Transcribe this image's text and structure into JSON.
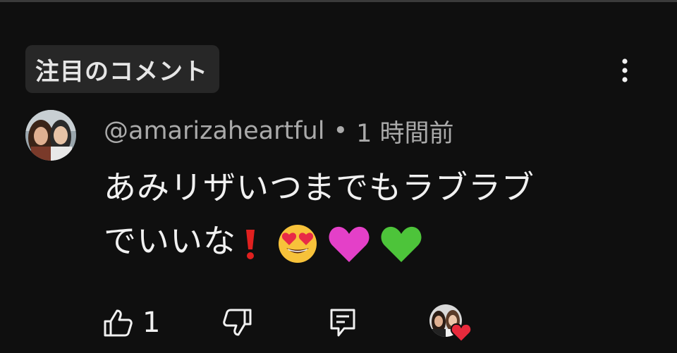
{
  "section": {
    "chip_label": "注目のコメント"
  },
  "comment": {
    "author": "@amarizaheartful",
    "separator": "•",
    "time": "1 時間前",
    "text_line1": "あみリザいつまでもラブラブ",
    "text_line2": "でいいな",
    "emojis": [
      "exclamation-mark",
      "heart-eyes",
      "pink-heart",
      "green-heart"
    ]
  },
  "actions": {
    "like_count": "1"
  },
  "colors": {
    "background": "#0f0f0f",
    "chip": "#272727",
    "text": "#f1f1f1",
    "secondary": "#aaaaaa"
  }
}
